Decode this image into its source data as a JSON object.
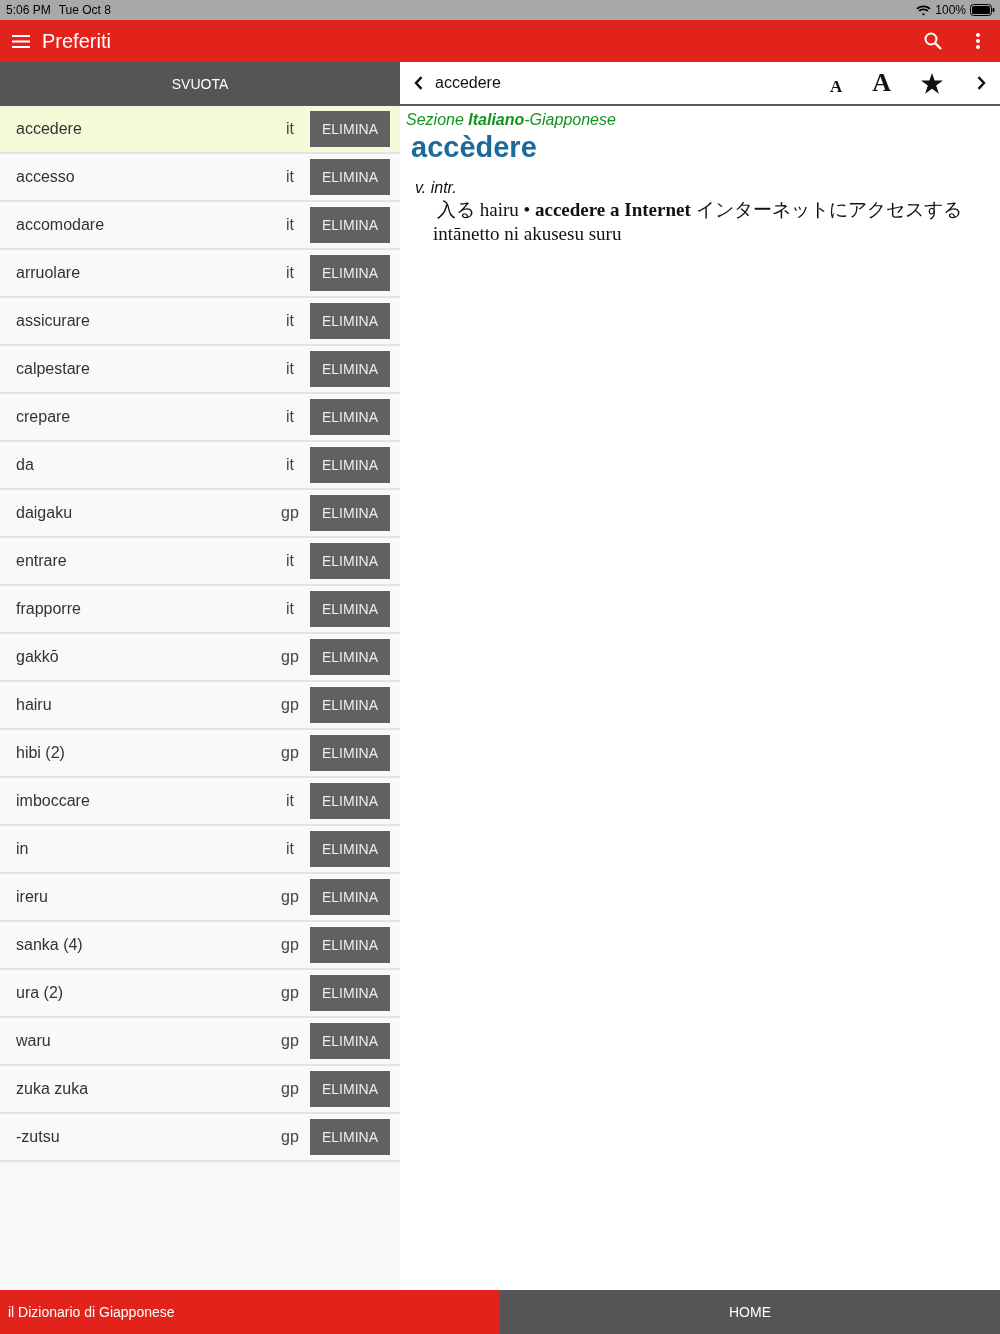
{
  "status_bar": {
    "time": "5:06 PM",
    "date": "Tue Oct 8",
    "battery": "100%"
  },
  "app_bar": {
    "title": "Preferiti"
  },
  "favorites": {
    "clear_button": "SVUOTA",
    "items": [
      {
        "word": "accedere",
        "lang": "it",
        "delete_button": "ELIMINA",
        "selected": true
      },
      {
        "word": "accesso",
        "lang": "it",
        "delete_button": "ELIMINA",
        "selected": false
      },
      {
        "word": "accomodare",
        "lang": "it",
        "delete_button": "ELIMINA",
        "selected": false
      },
      {
        "word": "arruolare",
        "lang": "it",
        "delete_button": "ELIMINA",
        "selected": false
      },
      {
        "word": "assicurare",
        "lang": "it",
        "delete_button": "ELIMINA",
        "selected": false
      },
      {
        "word": "calpestare",
        "lang": "it",
        "delete_button": "ELIMINA",
        "selected": false
      },
      {
        "word": "crepare",
        "lang": "it",
        "delete_button": "ELIMINA",
        "selected": false
      },
      {
        "word": "da",
        "lang": "it",
        "delete_button": "ELIMINA",
        "selected": false
      },
      {
        "word": "daigaku",
        "lang": "gp",
        "delete_button": "ELIMINA",
        "selected": false
      },
      {
        "word": "entrare",
        "lang": "it",
        "delete_button": "ELIMINA",
        "selected": false
      },
      {
        "word": "frapporre",
        "lang": "it",
        "delete_button": "ELIMINA",
        "selected": false
      },
      {
        "word": "gakkō",
        "lang": "gp",
        "delete_button": "ELIMINA",
        "selected": false
      },
      {
        "word": "hairu",
        "lang": "gp",
        "delete_button": "ELIMINA",
        "selected": false
      },
      {
        "word": "hibi (2)",
        "lang": "gp",
        "delete_button": "ELIMINA",
        "selected": false
      },
      {
        "word": "imboccare",
        "lang": "it",
        "delete_button": "ELIMINA",
        "selected": false
      },
      {
        "word": "in",
        "lang": "it",
        "delete_button": "ELIMINA",
        "selected": false
      },
      {
        "word": "ireru",
        "lang": "gp",
        "delete_button": "ELIMINA",
        "selected": false
      },
      {
        "word": "sanka (4)",
        "lang": "gp",
        "delete_button": "ELIMINA",
        "selected": false
      },
      {
        "word": "ura (2)",
        "lang": "gp",
        "delete_button": "ELIMINA",
        "selected": false
      },
      {
        "word": "waru",
        "lang": "gp",
        "delete_button": "ELIMINA",
        "selected": false
      },
      {
        "word": "zuka zuka",
        "lang": "gp",
        "delete_button": "ELIMINA",
        "selected": false
      },
      {
        "word": "-zutsu",
        "lang": "gp",
        "delete_button": "ELIMINA",
        "selected": false
      }
    ]
  },
  "entry": {
    "search_term": "accedere",
    "font_smaller": "A",
    "font_larger": "A",
    "section": "Sezione **Italiano**-Giapponese",
    "headword": "accèdere",
    "grammar": "v. intr.",
    "definition": "入る hairu • **accedere a Internet** インターネットにアクセスする intānetto ni akusesu suru"
  },
  "footer": {
    "app_name": "il Dizionario di Giapponese",
    "home_button": "HOME"
  }
}
